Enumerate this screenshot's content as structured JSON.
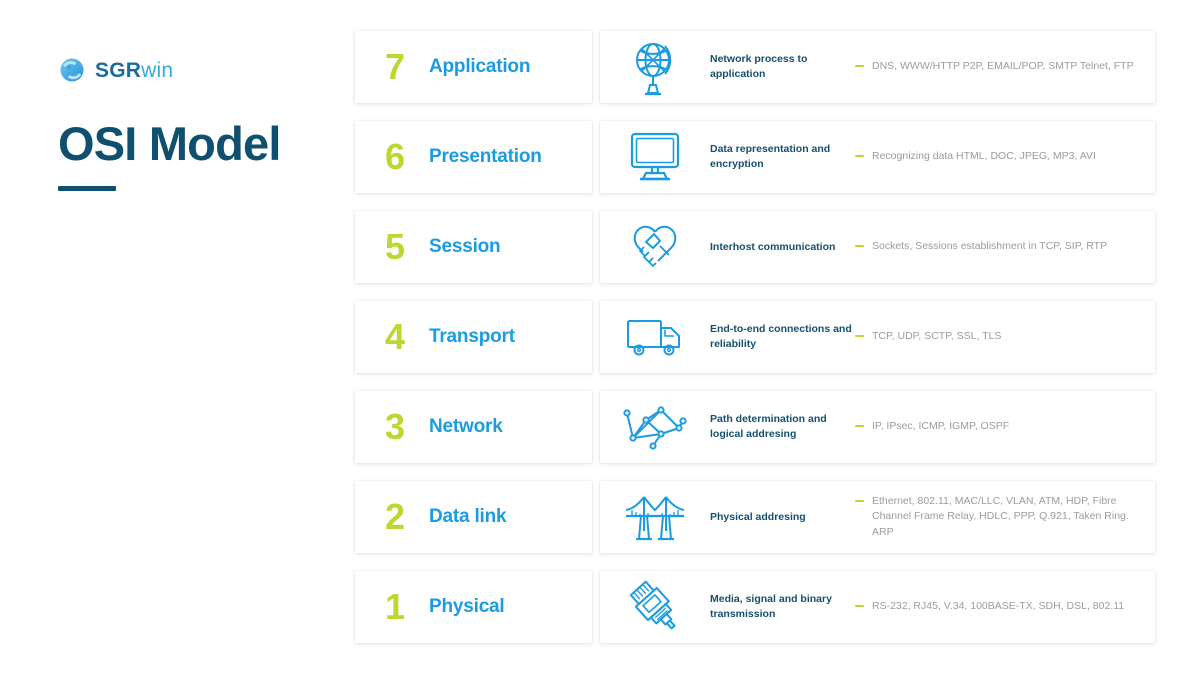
{
  "brand": {
    "logo_icon": "globe-logo-icon",
    "logo_primary": "SGR",
    "logo_secondary": "win",
    "title": "OSI Model"
  },
  "colors": {
    "number_green": "#bed630",
    "layer_blue": "#1b9ce0",
    "title_navy": "#10506f",
    "desc_navy": "#15506e",
    "protocol_gray": "#9c9c9c",
    "icon_blue": "#1b9ce0",
    "background": "#ffffff",
    "card": "#ffffff"
  },
  "layers": [
    {
      "number": "7",
      "name": "Application",
      "icon": "globe-stand-icon",
      "description": "Network process to application",
      "protocols": "DNS, WWW/HTTP P2P, EMAIL/POP, SMTP Telnet, FTP"
    },
    {
      "number": "6",
      "name": "Presentation",
      "icon": "monitor-icon",
      "description": "Data representation and encryption",
      "protocols": "Recognizing data HTML, DOC, JPEG, MP3, AVI"
    },
    {
      "number": "5",
      "name": "Session",
      "icon": "handshake-icon",
      "description": "Interhost communication",
      "protocols": "Sockets, Sessions establishment in TCP, SIP, RTP"
    },
    {
      "number": "4",
      "name": "Transport",
      "icon": "truck-icon",
      "description": "End-to-end connections and reliability",
      "protocols": "TCP, UDP, SCTP, SSL, TLS"
    },
    {
      "number": "3",
      "name": "Network",
      "icon": "network-mesh-icon",
      "description": "Path determination and logical addresing",
      "protocols": "IP, IPsec, ICMP, IGMP, OSPF"
    },
    {
      "number": "2",
      "name": "Data link",
      "icon": "bridge-icon",
      "description": "Physical addresing",
      "protocols": "Ethernet, 802.11, MAC/LLC, VLAN, ATM, HDP, Fibre Channel Frame Relay, HDLC, PPP, Q.921, Taken Ring. ARP"
    },
    {
      "number": "1",
      "name": "Physical",
      "icon": "rj45-connector-icon",
      "description": "Media, signal and binary transmission",
      "protocols": "RS-232, RJ45, V.34, 100BASE-TX, SDH, DSL, 802.11"
    }
  ]
}
